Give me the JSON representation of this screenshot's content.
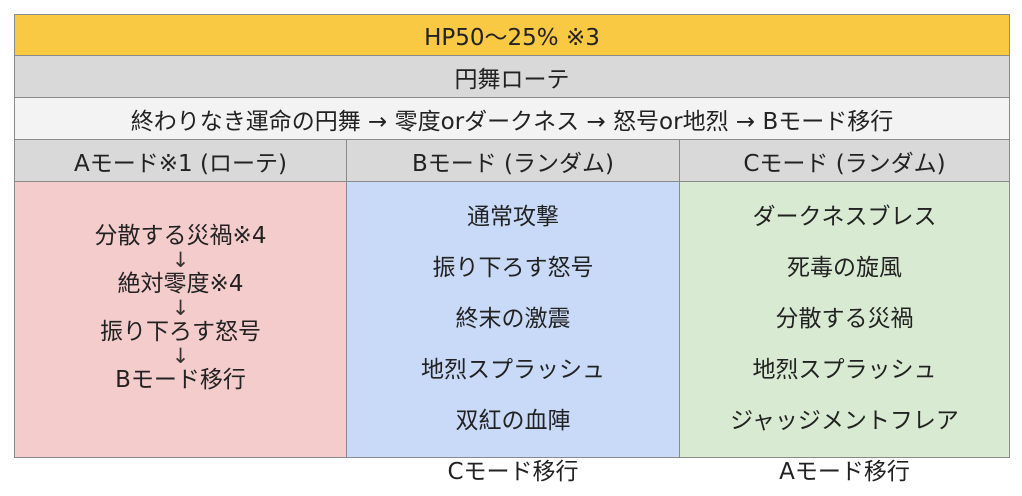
{
  "header": {
    "hp_range": "HP50〜25% ※3",
    "rotation_title": "円舞ローテ",
    "sequence": "終わりなき運命の円舞 → 零度orダークネス → 怒号or地烈 → Bモード移行"
  },
  "columns": [
    "Aモード※1 (ローテ)",
    "Bモード (ランダム)",
    "Cモード (ランダム)"
  ],
  "mode_a": {
    "steps": [
      "分散する災禍※4",
      "絶対零度※4",
      "振り下ろす怒号",
      "Bモード移行"
    ],
    "arrow": "↓"
  },
  "mode_b": {
    "items": [
      "通常攻撃",
      "振り下ろす怒号",
      "終末の激震",
      "地烈スプラッシュ",
      "双紅の血陣",
      "Cモード移行"
    ]
  },
  "mode_c": {
    "items": [
      "ダークネスブレス",
      "死毒の旋風",
      "分散する災禍",
      "地烈スプラッシュ",
      "ジャッジメントフレア",
      "Aモード移行"
    ]
  },
  "colors": {
    "hp_row": "#f9c943",
    "gray_row": "#d9d9d9",
    "mode_a_bg": "#f4cccc",
    "mode_b_bg": "#c9daf8",
    "mode_c_bg": "#d9ead3"
  }
}
